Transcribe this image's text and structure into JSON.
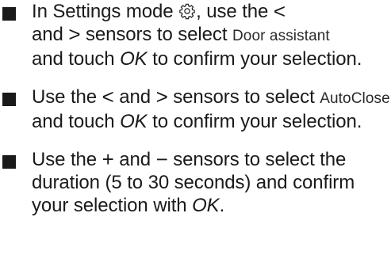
{
  "steps": [
    {
      "a": "In Settings mode",
      "icon": "gear-icon",
      "b": ", use the",
      "sym1": "<",
      "c": "and",
      "sym2": ">",
      "d": "sensors to select",
      "display": "Door assistant",
      "e": "and touch",
      "ok": "OK",
      "f": "to confirm your selection."
    },
    {
      "a": "Use the",
      "sym1": "<",
      "b": "and",
      "sym2": ">",
      "c": "sensors to select",
      "display": "AutoClose",
      "d": "and touch",
      "ok": "OK",
      "e": "to confirm your selection."
    },
    {
      "a": "Use the",
      "sym1": "+",
      "b": "and",
      "sym2": "−",
      "c": "sensors to select the duration (5 to 30 seconds) and confirm your selection with",
      "ok": "OK",
      "end": "."
    }
  ]
}
